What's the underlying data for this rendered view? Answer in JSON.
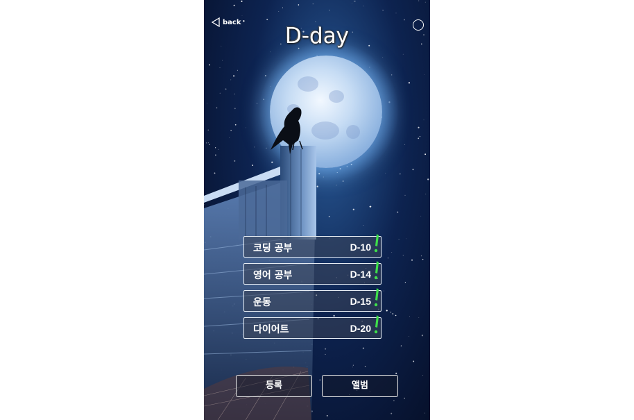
{
  "header": {
    "back_label": "back",
    "title": "D-day"
  },
  "dday_list": [
    {
      "name": "코딩 공부",
      "dday": "D-10"
    },
    {
      "name": "영어 공부",
      "dday": "D-14"
    },
    {
      "name": "운동",
      "dday": "D-15"
    },
    {
      "name": "다이어트",
      "dday": "D-20"
    }
  ],
  "buttons": {
    "register_label": "등록",
    "album_label": "앨범"
  },
  "colors": {
    "accent_mark": "#3ee04a",
    "border": "#e8eef5"
  },
  "icons": {
    "back": "back-triangle-icon",
    "settings": "circle-icon",
    "item_marker": "exclamation-icon"
  }
}
